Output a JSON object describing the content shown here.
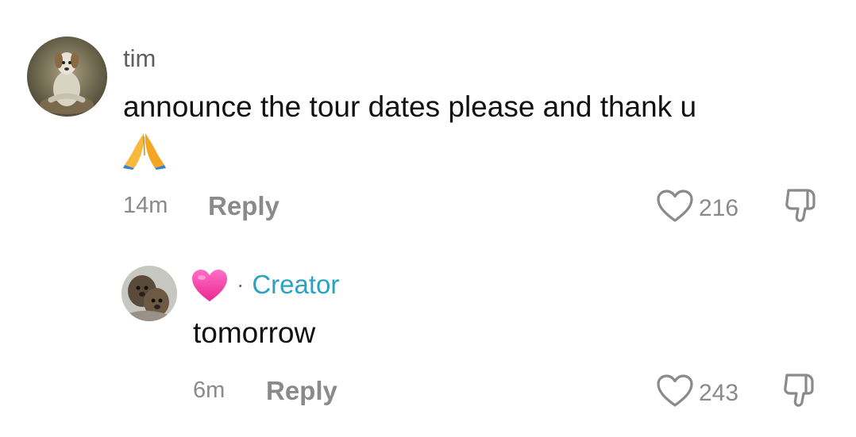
{
  "comments": [
    {
      "author": "tim",
      "text": "announce the tour dates please and thank u",
      "emoji": "folded-hands",
      "time": "14m",
      "reply_label": "Reply",
      "likes": "216"
    },
    {
      "author_emoji": "pink-heart",
      "separator": "·",
      "badge": "Creator",
      "text": "tomorrow",
      "time": "6m",
      "reply_label": "Reply",
      "likes": "243"
    }
  ],
  "colors": {
    "creator_badge": "#2aa2c2",
    "meta_gray": "#8a8a8a",
    "text": "#111111"
  }
}
